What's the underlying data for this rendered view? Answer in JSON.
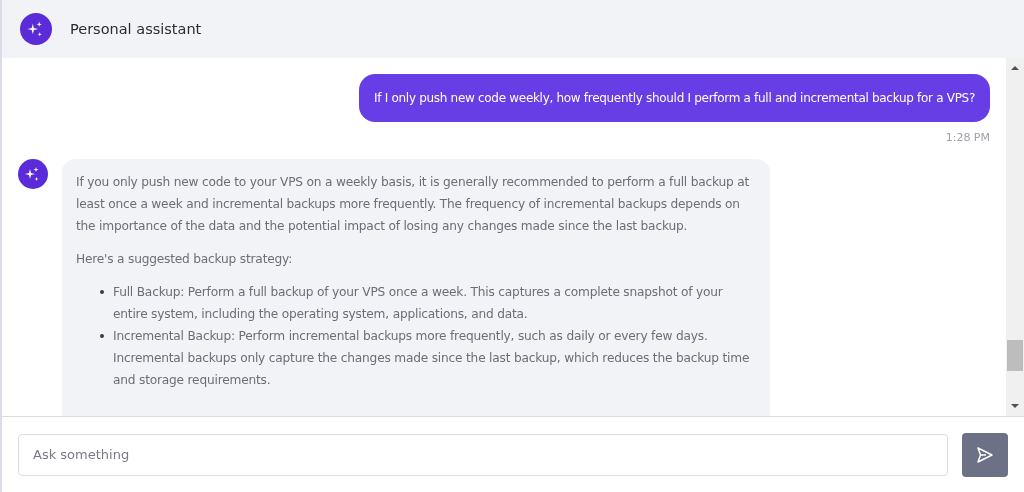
{
  "header": {
    "title": "Personal assistant"
  },
  "messages": [
    {
      "kind": "user",
      "text": "If I only push new code weekly, how frequently should I perform a full and incremental backup for a VPS?",
      "time": "1:28 PM"
    },
    {
      "kind": "assistant",
      "paragraphs": [
        "If you only push new code to your VPS on a weekly basis, it is generally recommended to perform a full backup at least once a week and incremental backups more frequently. The frequency of incremental backups depends on the importance of the data and the potential impact of losing any changes made since the last backup.",
        "Here's a suggested backup strategy:"
      ],
      "bullets": [
        "Full Backup: Perform a full backup of your VPS once a week. This captures a complete snapshot of your entire system, including the operating system, applications, and data.",
        "Incremental Backup: Perform incremental backups more frequently, such as daily or every few days. Incremental backups only capture the changes made since the last backup, which reduces the backup time and storage requirements."
      ]
    }
  ],
  "composer": {
    "placeholder": "Ask something"
  }
}
